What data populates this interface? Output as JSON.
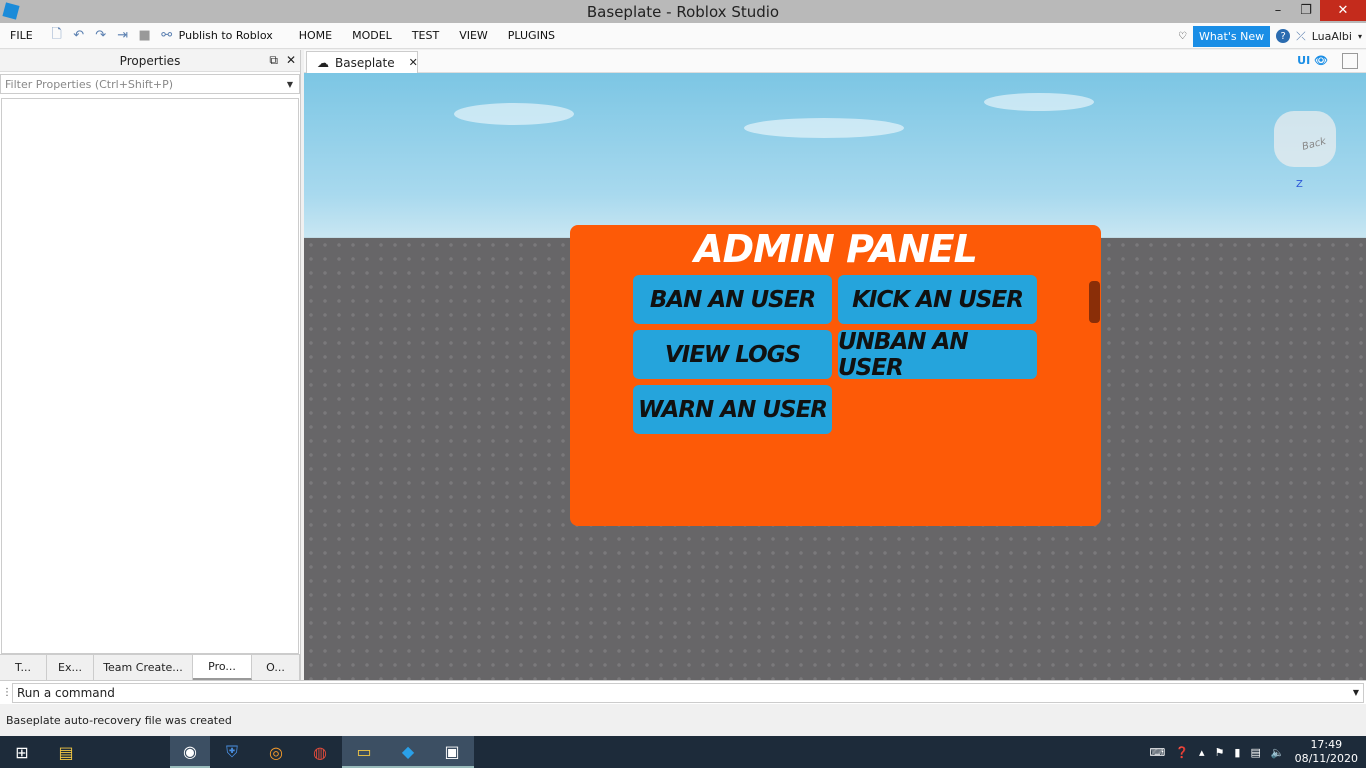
{
  "window": {
    "title": "Baseplate - Roblox Studio",
    "minimize": "–",
    "maximize": "❐",
    "close": "✕"
  },
  "menu": {
    "file": "FILE",
    "publish": "Publish to Roblox",
    "tabs": [
      "HOME",
      "MODEL",
      "TEST",
      "VIEW",
      "PLUGINS"
    ],
    "whats_new": "What's New",
    "user": "LuaAlbi"
  },
  "properties": {
    "title": "Properties",
    "filter_placeholder": "Filter Properties (Ctrl+Shift+P)",
    "tabs": [
      "T...",
      "Ex...",
      "Team Create...",
      "Pro...",
      "O..."
    ]
  },
  "document": {
    "tab_label": "Baseplate",
    "ui_toggle": "UI"
  },
  "viewport": {
    "compass_back": "Back",
    "compass_axis": "Z"
  },
  "admin_panel": {
    "title": "ADMIN PANEL",
    "buttons": {
      "ban": "BAN AN USER",
      "kick": "KICK AN USER",
      "logs": "VIEW LOGS",
      "unban": "UNBAN AN USER",
      "warn": "WARN AN USER"
    },
    "colors": {
      "panel": "#fd5a07",
      "button": "#25a4dc",
      "scroll": "#8a2e08"
    }
  },
  "command": {
    "placeholder": "Run a command"
  },
  "status": {
    "message": "Baseplate auto-recovery file was created"
  },
  "taskbar": {
    "time": "17:49",
    "date": "08/11/2020"
  }
}
